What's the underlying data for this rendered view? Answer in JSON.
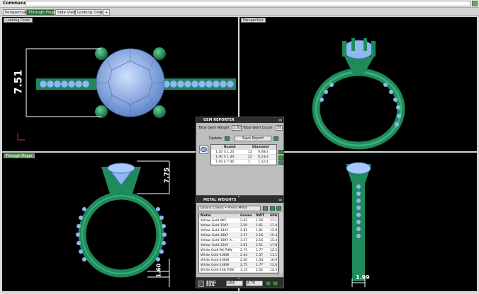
{
  "command": {
    "label": "Command:",
    "value": ""
  },
  "tabs": [
    {
      "label": "Perspective",
      "active": false
    },
    {
      "label": "Through Finger",
      "active": true
    },
    {
      "label": "Side View",
      "active": false
    },
    {
      "label": "Looking Down",
      "active": false
    },
    {
      "label": "+",
      "active": false
    }
  ],
  "viewports": {
    "top_left": {
      "label": "Looking Down",
      "dimension": "7.51"
    },
    "top_right": {
      "label": "Perspective"
    },
    "bottom_left": {
      "label": "Through Finger",
      "dimension_top": "7.75",
      "dimension_bottom": "1.60"
    },
    "bottom_right": {
      "label": "",
      "dimension": "1.99"
    }
  },
  "gem_reporter": {
    "title": "GEM REPORTER",
    "total_weight_label": "Total Gem Weight",
    "total_weight_value": "1.82",
    "total_count_label": "Total Gem Count",
    "total_count_value": "35",
    "update_label": "Update",
    "save_report_label": "Save Report",
    "columns": [
      "Round",
      "Diamond"
    ],
    "rows": [
      {
        "size": "1.20 X 1.20",
        "count": "12",
        "weight": "0.08ct"
      },
      {
        "size": "1.40 X 1.40",
        "count": "22",
        "weight": "0.23ct"
      },
      {
        "size": "7.40 X 7.40",
        "count": "1",
        "weight": "1.52ct"
      }
    ]
  },
  "metal_weights": {
    "title": "METAL WEIGHTS",
    "library_label": "Library: Classic • Precio Metal",
    "columns": [
      "Metal",
      "Grams",
      "DWT",
      "SPG"
    ],
    "rows": [
      {
        "metal": "Yellow Gold-9KY",
        "grams": "2.42",
        "dwt": "1.56",
        "spg": "11.1"
      },
      {
        "metal": "Yellow Gold-10KY",
        "grams": "2.50",
        "dwt": "1.61",
        "spg": "11.4"
      },
      {
        "metal": "Yellow Gold-14KY",
        "grams": "2.81",
        "dwt": "1.81",
        "spg": "12.9"
      },
      {
        "metal": "Yellow Gold-18KY",
        "grams": "3.37",
        "dwt": "2.16",
        "spg": "15.4"
      },
      {
        "metal": "Yellow Gold-18KY X...",
        "grams": "3.37",
        "dwt": "2.16",
        "spg": "15.4"
      },
      {
        "metal": "Yellow Gold-22KY",
        "grams": "3.91",
        "dwt": "2.51",
        "spg": "17.8"
      },
      {
        "metal": "White Gold-9K PdW",
        "grams": "2.75",
        "dwt": "1.77",
        "spg": "12.5"
      },
      {
        "metal": "White Gold-10KW",
        "grams": "2.44",
        "dwt": "1.57",
        "spg": "11.1"
      },
      {
        "metal": "White Gold-10KW",
        "grams": "2.40",
        "dwt": "1.54",
        "spg": "10.9"
      },
      {
        "metal": "White Gold-14KW",
        "grams": "2.75",
        "dwt": "1.77",
        "spg": "12.6"
      },
      {
        "metal": "White Gold-14K PdW",
        "grams": "3.14",
        "dwt": "2.02",
        "spg": "14.3"
      }
    ]
  },
  "ring_rail": {
    "title": "RING RAIL",
    "standard": "USA",
    "size": "6.75"
  },
  "colors": {
    "metal": "#1f8a5a",
    "gem": "#8fb8f2",
    "viewport_bg": "#000000",
    "active_tab": "#2d6a3a"
  }
}
